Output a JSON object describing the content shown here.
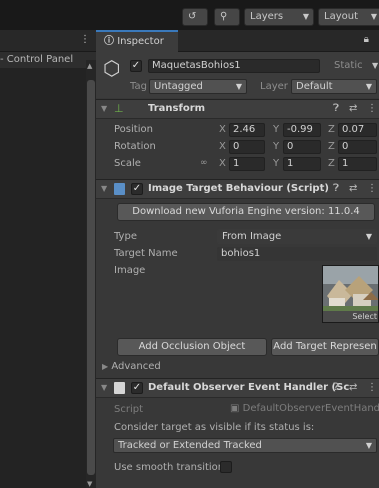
{
  "topbar": {
    "history_icon": "history-icon",
    "search_icon": "search-icon",
    "layers_label": "Layers",
    "layout_label": "Layout"
  },
  "left_panel": {
    "row_label": "- Control Panel"
  },
  "inspector": {
    "tab_label": "Inspector",
    "object": {
      "active": true,
      "name": "MaquetasBohios1",
      "static_label": "Static",
      "tag_label": "Tag",
      "tag_value": "Untagged",
      "layer_label": "Layer",
      "layer_value": "Default"
    },
    "transform": {
      "title": "Transform",
      "rows": [
        {
          "label": "Position",
          "x": "2.46",
          "y": "-0.99",
          "z": "0.07"
        },
        {
          "label": "Rotation",
          "x": "0",
          "y": "0",
          "z": "0"
        },
        {
          "label": "Scale",
          "x": "1",
          "y": "1",
          "z": "1"
        }
      ]
    },
    "image_target": {
      "title": "Image Target Behaviour (Script)",
      "enabled": true,
      "download_button": "Download new Vuforia Engine version: 11.0.4",
      "type_label": "Type",
      "type_value": "From Image",
      "target_name_label": "Target Name",
      "target_name_value": "bohios1",
      "image_label": "Image",
      "select_label": "Select",
      "add_occlusion_button": "Add Occlusion Object",
      "add_target_button": "Add Target Represen",
      "advanced_label": "Advanced"
    },
    "observer_handler": {
      "title": "Default Observer Event Handler (Sc",
      "enabled": true,
      "script_label": "Script",
      "script_value": "DefaultObserverEventHand",
      "consider_label": "Consider target as visible if its status is:",
      "status_value": "Tracked or Extended Tracked",
      "smooth_label": "Use smooth transition"
    }
  },
  "colors": {
    "background": "#383838",
    "accent": "#3a79bb"
  }
}
